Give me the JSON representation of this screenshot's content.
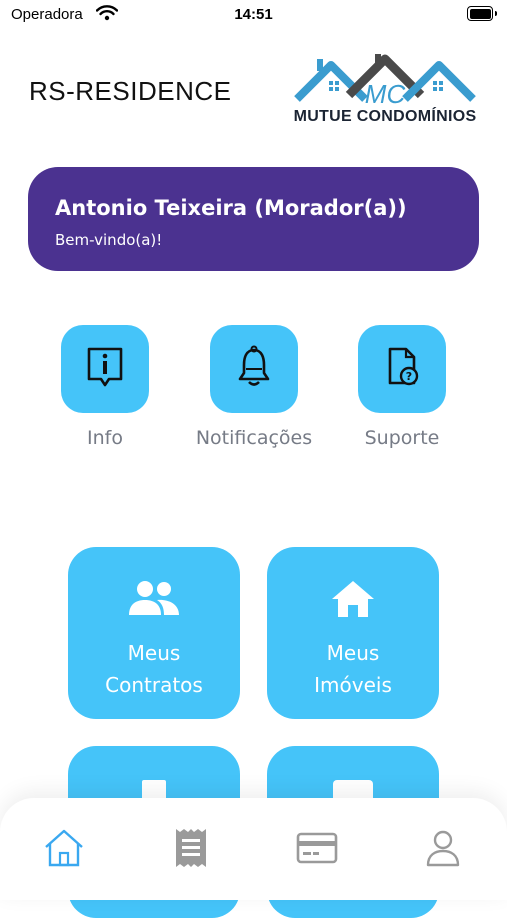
{
  "status_bar": {
    "carrier": "Operadora",
    "time": "14:51"
  },
  "header": {
    "title": "RS-RESIDENCE",
    "logo_text": "MUTUE CONDOMÍNIOS",
    "logo_monogram": "MC"
  },
  "welcome": {
    "name": "Antonio Teixeira (Morador(a))",
    "greeting": "Bem-vindo(a)!"
  },
  "quick_actions": [
    {
      "label": "Info",
      "icon": "info-book-icon"
    },
    {
      "label": "Notificações",
      "icon": "bell-icon"
    },
    {
      "label": "Suporte",
      "icon": "document-help-icon"
    }
  ],
  "tiles": [
    {
      "line1": "Meus",
      "line2": "Contratos",
      "icon": "people-icon"
    },
    {
      "line1": "Meus",
      "line2": "Imóveis",
      "icon": "house-icon"
    }
  ],
  "bottom_nav": [
    "home-icon",
    "receipt-icon",
    "credit-card-icon",
    "user-icon"
  ],
  "colors": {
    "accent": "#45c4f9",
    "card": "#4b3290",
    "label_gray": "#767b86",
    "nav_active": "#3aa8f0",
    "nav_inactive": "#9a9a9a"
  }
}
